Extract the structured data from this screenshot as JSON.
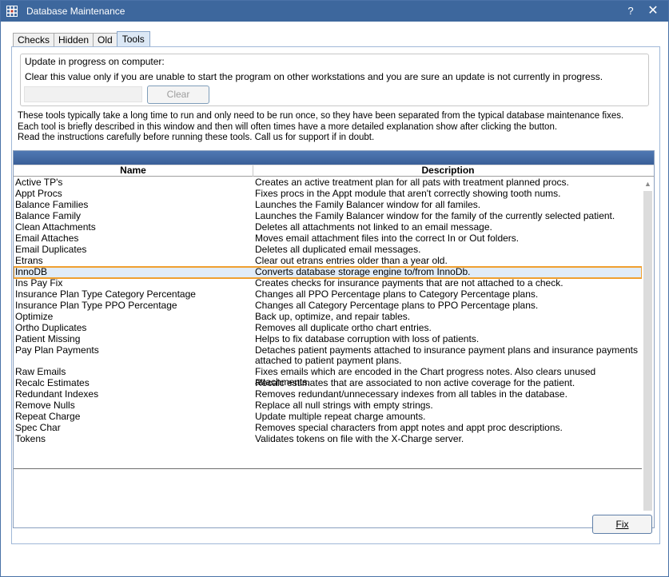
{
  "window": {
    "title": "Database Maintenance",
    "help_label": "?",
    "close_label": "✕"
  },
  "tabs": [
    {
      "label": "Checks",
      "active": false
    },
    {
      "label": "Hidden",
      "active": false
    },
    {
      "label": "Old",
      "active": false
    },
    {
      "label": "Tools",
      "active": true
    }
  ],
  "update_group": {
    "title": "Update in progress on computer:",
    "description": "Clear this value only if you are unable to start the program on other workstations and you are sure an update is not currently in progress.",
    "value": "",
    "clear_label": "Clear"
  },
  "info_lines": [
    "These tools typically take a long time to run and only need to be run once, so they have been separated from the typical database maintenance fixes.",
    "Each tool is briefly described in this window and then will often times have a more detailed explanation show after clicking the button.",
    "Read the instructions carefully before running these tools.  Call us for support if in doubt."
  ],
  "grid": {
    "columns": {
      "name": "Name",
      "description": "Description"
    },
    "rows": [
      {
        "name": "Active TP's",
        "description": "Creates an active treatment plan for all pats with treatment planned procs."
      },
      {
        "name": "Appt Procs",
        "description": "Fixes procs in the Appt module that aren't correctly showing tooth nums."
      },
      {
        "name": "Balance Families",
        "description": "Launches the Family Balancer window for all familes."
      },
      {
        "name": "Balance Family",
        "description": "Launches the Family Balancer window for the family of the currently selected patient."
      },
      {
        "name": "Clean Attachments",
        "description": "Deletes all attachments not linked to an email message."
      },
      {
        "name": "Email Attaches",
        "description": "Moves email attachment files into the correct In or Out folders."
      },
      {
        "name": "Email Duplicates",
        "description": "Deletes all duplicated email messages."
      },
      {
        "name": "Etrans",
        "description": "Clear out etrans entries older than a year old."
      },
      {
        "name": "InnoDB",
        "description": "Converts database storage engine to/from InnoDb.",
        "selected": true
      },
      {
        "name": "Ins Pay Fix",
        "description": "Creates checks for insurance payments that are not attached to a check."
      },
      {
        "name": "Insurance Plan Type Category Percentage",
        "description": "Changes all PPO Percentage plans to Category Percentage plans."
      },
      {
        "name": "Insurance Plan Type PPO Percentage",
        "description": "Changes all Category Percentage plans to PPO Percentage plans."
      },
      {
        "name": "Optimize",
        "description": "Back up, optimize, and repair tables."
      },
      {
        "name": "Ortho Duplicates",
        "description": "Removes all duplicate ortho chart entries."
      },
      {
        "name": "Patient Missing",
        "description": "Helps to fix database corruption with loss of patients."
      },
      {
        "name": "Pay Plan Payments",
        "description": "Detaches patient payments attached to insurance payment plans and insurance payments attached to patient payment plans.",
        "tall": true
      },
      {
        "name": "Raw Emails",
        "description": "Fixes emails which are encoded in the Chart progress notes.  Also clears unused attachments."
      },
      {
        "name": "Recalc Estimates",
        "description": "Recalc estimates that are associated to non active coverage for the patient."
      },
      {
        "name": "Redundant Indexes",
        "description": "Removes redundant/unnecessary indexes from all tables in the database."
      },
      {
        "name": "Remove Nulls",
        "description": "Replace all null strings with empty strings."
      },
      {
        "name": "Repeat Charge",
        "description": "Update multiple repeat charge amounts."
      },
      {
        "name": "Spec Char",
        "description": "Removes special characters from appt notes and appt proc descriptions."
      },
      {
        "name": "Tokens",
        "description": "Validates tokens on file with the X-Charge server."
      }
    ]
  },
  "scrollbar": {
    "up": "▲",
    "down": "▼"
  },
  "fix_button": {
    "label": "Fix"
  }
}
